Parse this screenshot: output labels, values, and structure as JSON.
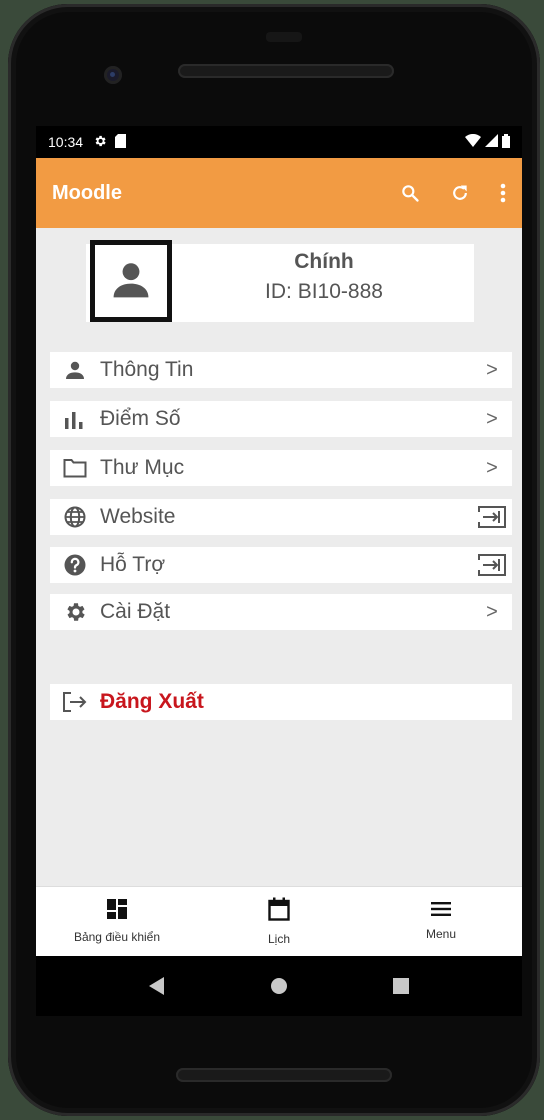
{
  "status_bar": {
    "time": "10:34",
    "icons": [
      "gear-icon",
      "sim-card-icon"
    ],
    "right_icons": [
      "wifi-icon",
      "signal-icon",
      "battery-icon"
    ]
  },
  "app_bar": {
    "title": "Moodle",
    "background": "#f29b43",
    "actions": [
      "search-icon",
      "refresh-icon",
      "more-vert-icon"
    ]
  },
  "profile": {
    "name": "Chính",
    "id": "ID: BI10-888",
    "avatar_icon": "person-icon"
  },
  "menu": {
    "items": [
      {
        "label": "Thông Tin",
        "icon": "person-icon",
        "trailing": "chevron-right-icon",
        "trailing_glyph": ">"
      },
      {
        "label": "Điểm Số",
        "icon": "bar-chart-icon",
        "trailing": "chevron-right-icon",
        "trailing_glyph": ">"
      },
      {
        "label": "Thư Mục",
        "icon": "folder-icon",
        "trailing": "chevron-right-icon",
        "trailing_glyph": ">"
      },
      {
        "label": "Website",
        "icon": "globe-icon",
        "trailing": "open-external-icon"
      },
      {
        "label": "Hỗ Trợ",
        "icon": "help-icon",
        "trailing": "open-external-icon"
      },
      {
        "label": "Cài Đặt",
        "icon": "settings-icon",
        "trailing": "chevron-right-icon",
        "trailing_glyph": ">"
      }
    ]
  },
  "logout": {
    "label": "Đăng Xuất",
    "icon": "logout-icon",
    "color": "#c8161d"
  },
  "bottom_nav": {
    "items": [
      {
        "label": "Bảng điều khiển",
        "icon": "dashboard-icon"
      },
      {
        "label": "Lịch",
        "icon": "calendar-icon"
      },
      {
        "label": "Menu",
        "icon": "menu-icon"
      }
    ]
  },
  "system_nav": {
    "buttons": [
      "back-icon",
      "home-icon",
      "recents-icon"
    ]
  }
}
